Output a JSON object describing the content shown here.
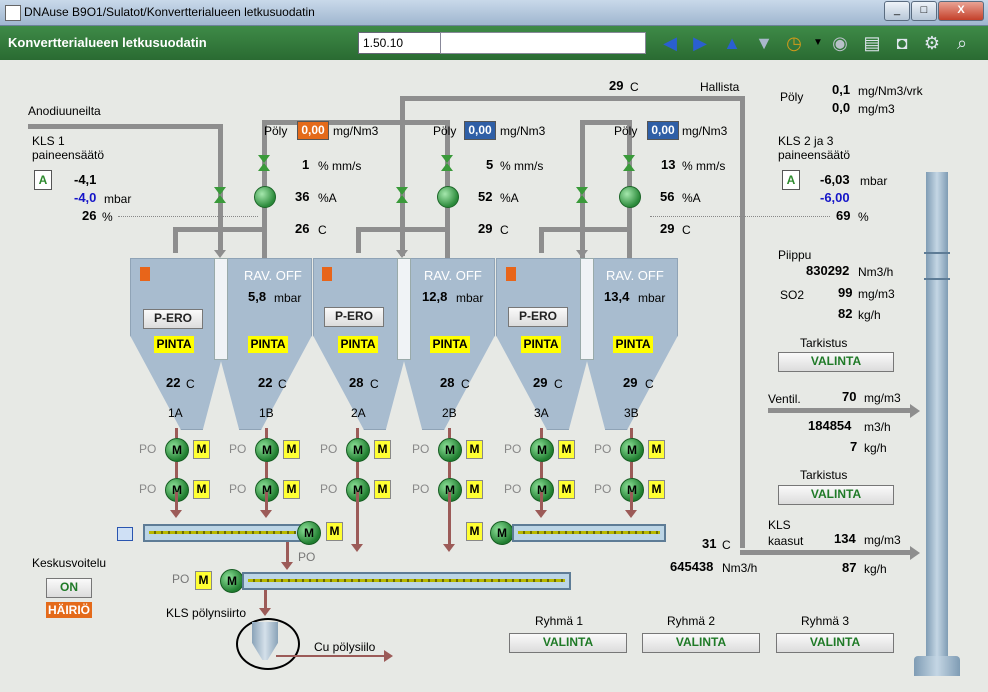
{
  "window": {
    "title": "DNAuse B9O1/Sulatot/Konvertterialueen letkusuodatin",
    "min": "_",
    "max": "□",
    "close": "X"
  },
  "header": {
    "title": "Konvertterialueen letkusuodatin",
    "version": "1.50.10"
  },
  "toolbar": {
    "icons": [
      "arrow-left-icon",
      "arrow-right-icon",
      "arrow-up-icon",
      "arrow-down-icon",
      "clock-icon",
      "dropdown-icon",
      "disabled-icon",
      "print-icon",
      "camera-icon",
      "settings-icon",
      "zoom-icon"
    ]
  },
  "top": {
    "temp": "29",
    "temp_unit": "C",
    "hallista": "Hallista",
    "anodi": "Anodiuuneilta"
  },
  "kls1": {
    "title": "KLS 1",
    "sub": "paineensäätö",
    "a": "A",
    "v1": "-4,1",
    "v2": "-4,0",
    "v2_unit": "mbar",
    "pct": "26",
    "pct_unit": "%"
  },
  "kls23": {
    "title": "KLS 2 ja 3",
    "sub": "paineensäätö",
    "a": "A",
    "v1": "-6,03",
    "v1_unit": "mbar",
    "v2": "-6,00",
    "pct": "69",
    "pct_unit": "%"
  },
  "right": {
    "poly_label": "Pöly",
    "poly1": "0,1",
    "poly1_unit": "mg/Nm3/vrk",
    "poly2": "0,0",
    "poly2_unit": "mg/m3",
    "piippu": "Piippu",
    "piippu_val": "830292",
    "piippu_unit": "Nm3/h",
    "so2": "SO2",
    "so2_val": "99",
    "so2_unit": "mg/m3",
    "so2_kg": "82",
    "so2_kg_unit": "kg/h",
    "tarkistus1": "Tarkistus",
    "valinta1": "VALINTA",
    "ventil": "Ventil.",
    "ventil_val": "70",
    "ventil_unit": "mg/m3",
    "ventil_flow": "184854",
    "ventil_flow_unit": "m3/h",
    "ventil_kg": "7",
    "ventil_kg_unit": "kg/h",
    "tarkistus2": "Tarkistus",
    "valinta2": "VALINTA",
    "kls_kaasut1": "KLS",
    "kls_kaasut2": "kaasut",
    "kaasut_val": "134",
    "kaasut_unit": "mg/m3",
    "kaasut_kg": "87",
    "kaasut_kg_unit": "kg/h"
  },
  "units": [
    {
      "poly_label": "Pöly",
      "poly": "0,00",
      "poly_unit": "mg/Nm3",
      "poly_color": "#e46a1a",
      "mms": "1",
      "mms_unit": "% mm/s",
      "a": "36",
      "a_unit": "%A",
      "t": "26",
      "t_unit": "C",
      "rav": "RAV. OFF",
      "mbar": "5,8",
      "mbar_unit": "mbar",
      "pero": "P-ERO",
      "pinta_a": "PINTA",
      "pinta_b": "PINTA",
      "temp_a": "22",
      "temp_b": "22",
      "c": "C",
      "name_a": "1A",
      "name_b": "1B"
    },
    {
      "poly_label": "Pöly",
      "poly": "0,00",
      "poly_unit": "mg/Nm3",
      "poly_color": "#2f5fa6",
      "mms": "5",
      "mms_unit": "% mm/s",
      "a": "52",
      "a_unit": "%A",
      "t": "29",
      "t_unit": "C",
      "rav": "RAV. OFF",
      "mbar": "12,8",
      "mbar_unit": "mbar",
      "pero": "P-ERO",
      "pinta_a": "PINTA",
      "pinta_b": "PINTA",
      "temp_a": "28",
      "temp_b": "28",
      "c": "C",
      "name_a": "2A",
      "name_b": "2B"
    },
    {
      "poly_label": "Pöly",
      "poly": "0,00",
      "poly_unit": "mg/Nm3",
      "poly_color": "#2f5fa6",
      "mms": "13",
      "mms_unit": "% mm/s",
      "a": "56",
      "a_unit": "%A",
      "t": "29",
      "t_unit": "C",
      "rav": "RAV. OFF",
      "mbar": "13,4",
      "mbar_unit": "mbar",
      "pero": "P-ERO",
      "pinta_a": "PINTA",
      "pinta_b": "PINTA",
      "temp_a": "29",
      "temp_b": "29",
      "c": "C",
      "name_a": "3A",
      "name_b": "3B"
    }
  ],
  "motors": {
    "po": "PO",
    "m": "M",
    "mbox": "M"
  },
  "bottom": {
    "po1": "PO",
    "po2": "PO",
    "temp": "31",
    "temp_unit": "C",
    "flow": "645438",
    "flow_unit": "Nm3/h",
    "keskusvoitelu": "Keskusvoitelu",
    "on": "ON",
    "hairio": "HÄIRIÖ",
    "siirto": "KLS pölynsiirto",
    "siilo": "Cu pölysiilo",
    "groups": [
      {
        "label": "Ryhmä 1",
        "btn": "VALINTA"
      },
      {
        "label": "Ryhmä 2",
        "btn": "VALINTA"
      },
      {
        "label": "Ryhmä 3",
        "btn": "VALINTA"
      }
    ]
  }
}
